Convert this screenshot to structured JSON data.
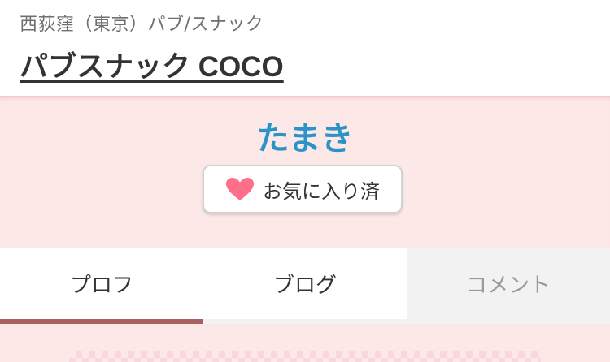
{
  "header": {
    "breadcrumb": "西荻窪（東京）パブ/スナック",
    "shop_name": "パブスナック COCO"
  },
  "profile": {
    "cast_name": "たまき",
    "favorite_button": {
      "icon": "heart-icon",
      "label": "お気に入り済",
      "icon_color": "#ff6f8a"
    }
  },
  "tabs": [
    {
      "label": "プロフ",
      "active": true
    },
    {
      "label": "ブログ",
      "active": false
    },
    {
      "label": "コメント",
      "active": false
    }
  ],
  "colors": {
    "accent": "#2a94c8",
    "active_tab_indicator": "#a86060",
    "pink_background": "#fde8e8"
  }
}
